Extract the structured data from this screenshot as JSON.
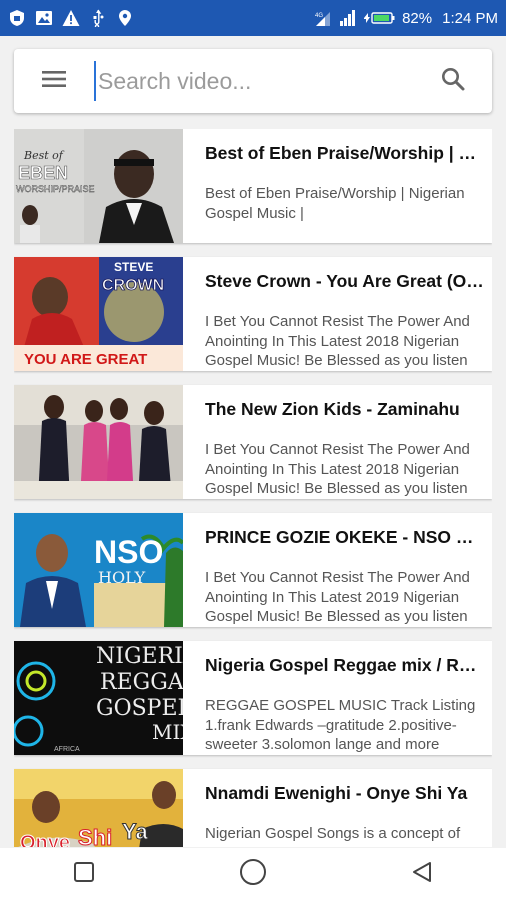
{
  "status_bar": {
    "left_icons": [
      "shield-icon",
      "image-icon",
      "warning-icon",
      "usb-icon",
      "location-icon"
    ],
    "battery": "82%",
    "time": "1:24 PM"
  },
  "search": {
    "placeholder": "Search video...",
    "value": ""
  },
  "videos": [
    {
      "title": "Best of Eben Praise/Worship | Nigerian Gospel Music |",
      "description": "Best of Eben Praise/Worship | Nigerian Gospel Music |",
      "thumbnail_text": [
        "Best of",
        "EBEN",
        "WORSHIP/PRAISE"
      ]
    },
    {
      "title": "Steve Crown - You Are Great (Official Video)",
      "description": "I Bet You Cannot Resist The Power And Anointing In This Latest 2018 Nigerian Gospel Music! Be Blessed as you listen",
      "thumbnail_text": [
        "STEVE",
        "CROWN",
        "YOU ARE GREAT"
      ]
    },
    {
      "title": "The New Zion Kids - Zaminahu",
      "description": "I Bet You Cannot Resist The Power And Anointing In This Latest 2018 Nigerian Gospel Music! Be Blessed as you listen",
      "thumbnail_text": []
    },
    {
      "title": "PRINCE GOZIE OKEKE - NSO HOLY",
      "description": "I Bet You Cannot Resist The Power And Anointing In This Latest 2019 Nigerian Gospel Music! Be Blessed as you listen",
      "thumbnail_text": [
        "NSO",
        "HOLY"
      ]
    },
    {
      "title": "Nigeria Gospel Reggae mix / Reggae Gospel",
      "description": "REGGAE GOSPEL MUSIC Track Listing 1.frank Edwards –gratitude 2.positive-sweeter 3.solomon lange and more",
      "thumbnail_text": [
        "NIGERIA",
        "REGGAE",
        "GOSPEL",
        "MIX",
        "AFRICA"
      ]
    },
    {
      "title": "Nnamdi Ewenighi - Onye Shi Ya",
      "description": "Nigerian Gospel Songs is a concept of Praise AllStar Channel. Nnamdi Ewenighi",
      "thumbnail_text": [
        "Onye",
        "Shi",
        "Ya"
      ]
    }
  ],
  "colors": {
    "status_bar": "#1e58b2",
    "background": "#f1f1f1",
    "cursor": "#2a73d8"
  },
  "nav_bar": [
    "recents-square-icon",
    "home-circle-icon",
    "back-triangle-icon"
  ]
}
